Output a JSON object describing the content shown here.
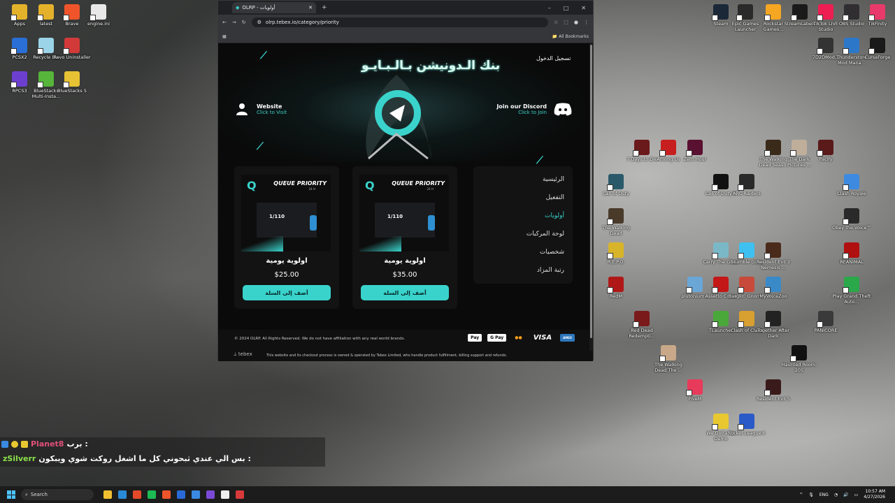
{
  "desktop_left": [
    {
      "label": "Apps",
      "color": "#e4b22a"
    },
    {
      "label": "latest",
      "color": "#e4b22a"
    },
    {
      "label": "Brave",
      "color": "#f0542a"
    },
    {
      "label": "engine.ini",
      "color": "#e8e8e8"
    },
    {
      "label": "PCSX2",
      "color": "#2a6fd6"
    },
    {
      "label": "Recycle Bin",
      "color": "#9bd3e8"
    },
    {
      "label": "Revo Uninstaller",
      "color": "#d23a3a"
    },
    {
      "label": "RPCS3",
      "color": "#6d3fd1"
    },
    {
      "label": "BlueStacks Multi-Insta...",
      "color": "#56b53a"
    },
    {
      "label": "BlueStacks 5",
      "color": "#e6c234"
    }
  ],
  "desktop_top_right": [
    {
      "label": "Steam",
      "color": "#1b2838"
    },
    {
      "label": "Epic Games Launcher",
      "color": "#2a2a2a"
    },
    {
      "label": "Rockstar Games...",
      "color": "#f5a623"
    },
    {
      "label": "StreamLabels",
      "color": "#1a1a1a"
    },
    {
      "label": "TikTok LIVE Studio",
      "color": "#ee1d52"
    },
    {
      "label": "OBS Studio",
      "color": "#302e31"
    },
    {
      "label": "TikFinity",
      "color": "#e83a6a"
    },
    {
      "label": "7D2DMod...",
      "color": "#333"
    },
    {
      "label": "Thunderstore Mod Mana...",
      "color": "#2d77c9"
    },
    {
      "label": "CurseForge",
      "color": "#1a1a1a"
    }
  ],
  "desktop_games": [
    {
      "label": "7 Days to Die",
      "color": "#6a1a1a"
    },
    {
      "label": "Among Us",
      "color": "#c71f1f"
    },
    {
      "label": "Zero Hour",
      "color": "#5a1030"
    },
    {
      "label": "The Walking Dead Seas...",
      "color": "#3a2a1a"
    },
    {
      "label": "The Dark Pictures ...",
      "color": "#bfae9a"
    },
    {
      "label": "Pacify",
      "color": "#5a1a1a"
    },
    {
      "label": "Call of Duty",
      "color": "#2a5a6a"
    },
    {
      "label": "Call of Duty®",
      "color": "#111"
    },
    {
      "label": "ARC Raiders",
      "color": "#2a2a2a"
    },
    {
      "label": "Clash Royale",
      "color": "#3d8ae0"
    },
    {
      "label": "The Walking Dead",
      "color": "#4a3a2a"
    },
    {
      "label": "Obey the Voice™",
      "color": "#2a2a2a"
    },
    {
      "label": "R.E.P.O.",
      "color": "#d8b42a"
    },
    {
      "label": "Carry The Glass",
      "color": "#7ab8c8"
    },
    {
      "label": "Stumble Guys",
      "color": "#3ec1f0"
    },
    {
      "label": "Resident Evil 3 Nemesis ...",
      "color": "#4a2a1a"
    },
    {
      "label": "REANIMAL",
      "color": "#b01010"
    },
    {
      "label": "RedM",
      "color": "#b01818"
    },
    {
      "label": "plutonium...",
      "color": "#6aa6d6"
    },
    {
      "label": "Assetto Corsa",
      "color": "#c41818"
    },
    {
      "label": "Burglin' Gnom...",
      "color": "#c84a3a"
    },
    {
      "label": "MyVoiceZoo",
      "color": "#3a8ac8"
    },
    {
      "label": "Play Grand Theft Auto...",
      "color": "#2aa84a"
    },
    {
      "label": "Red Dead Redempti...",
      "color": "#7a1a1a"
    },
    {
      "label": "TLauncher",
      "color": "#4aa83a"
    },
    {
      "label": "Clash of Clans",
      "color": "#d8a030"
    },
    {
      "label": "Together After Dark",
      "color": "#222"
    },
    {
      "label": "PANICORE",
      "color": "#3a3a3a"
    },
    {
      "label": "The Walking Dead The ...",
      "color": "#c8a888"
    },
    {
      "label": "Haunted Room: 205",
      "color": "#111"
    },
    {
      "label": "FiveM",
      "color": "#e83a5a"
    },
    {
      "label": "Resident Evil 5",
      "color": "#3a1a1a"
    },
    {
      "label": "We Gotta Go Demo",
      "color": "#e8c830"
    },
    {
      "label": "Rocket League®",
      "color": "#2a5ac8"
    }
  ],
  "browser": {
    "tab_title": "OLRP - أولويات",
    "url": "olrp.tebex.io/category/priority",
    "bookmarks": "All Bookmarks",
    "banner": "بنك الـدونيشن بـالـبـايـو",
    "login": "تسجيل الدخول",
    "website_title": "Website",
    "website_sub": "Click to Visit",
    "discord_title": "Join our Discord",
    "discord_sub": "Click to Join",
    "cards": [
      {
        "image_title": "QUEUE PRIORITY",
        "image_sub": "24 H",
        "ratio": "1/110",
        "name": "اولوية يومية",
        "price": "$35.00",
        "button": "أضف إلى السلة"
      },
      {
        "image_title": "QUEUE PRIORITY",
        "image_sub": "24 H",
        "ratio": "1/110",
        "name": "اولوية يومية",
        "price": "$25.00",
        "button": "أضف إلى السلة"
      }
    ],
    "menu": [
      "الرئيسية",
      "التفعيل",
      "أولويات",
      "لوحة المركبات",
      "شخصيات",
      "رتبة المزاد"
    ],
    "menu_active": 2,
    "copyright": "© 2024 OLRP. All Rights Reserved. We do not have affiliation with any real world brands.",
    "payments": [
      "Pay",
      "G Pay",
      "●●",
      "VISA",
      "AMEX"
    ],
    "tebex": "tebex",
    "tebex_note": "This website and its checkout process is owned & operated by Tebex Limited, who handle product fulfillment, billing support and refunds."
  },
  "chat": {
    "user1": "Planet8",
    "msg1": "برب :",
    "user1_color": "#e0507a",
    "user2": "zSilverr",
    "msg2": "بس الي عندي ثبحوني كل ما اشغل روكت شوي ويبكون :",
    "user2_color": "#8be04a"
  },
  "taskbar": {
    "search_placeholder": "Search",
    "lang": "ENG",
    "time": "10:57 AM",
    "date": "4/27/2026",
    "icons": [
      "#f0c030",
      "#2a8ad6",
      "#e44a2a",
      "#1db954",
      "#f0542a",
      "#2a6ad6",
      "#3a8ae0",
      "#7a4ad6",
      "#eee",
      "#d63a3a"
    ]
  }
}
